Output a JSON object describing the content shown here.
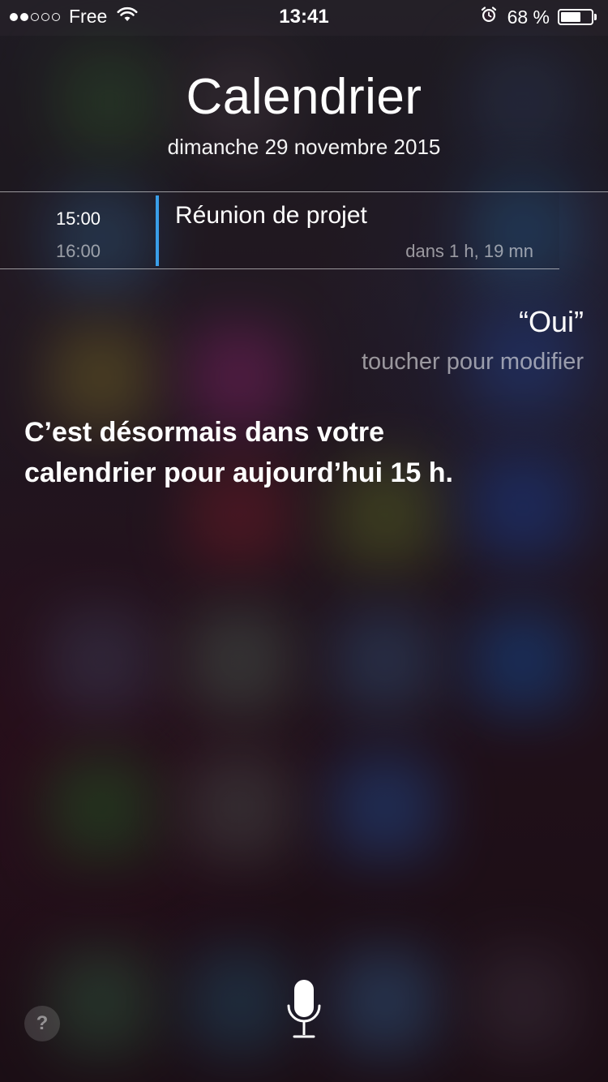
{
  "status_bar": {
    "carrier": "Free",
    "signal_bars_filled": 2,
    "signal_bars_total": 5,
    "time": "13:41",
    "battery_percent_label": "68 %",
    "battery_level": 0.68,
    "icons": [
      "wifi-icon",
      "alarm-icon",
      "battery-icon"
    ]
  },
  "calendar_card": {
    "title": "Calendrier",
    "date": "dimanche 29 novembre 2015",
    "event": {
      "start_time": "15:00",
      "end_time": "16:00",
      "title": "Réunion de projet",
      "relative_time": "dans 1 h, 19 mn",
      "accent_color": "#3a9ee8"
    }
  },
  "siri": {
    "user_utterance": "“Oui”",
    "edit_hint": "toucher pour modifier",
    "response": "C’est désormais dans votre calendrier pour aujourd’hui 15 h."
  },
  "controls": {
    "help_label": "?",
    "mic_icon": "microphone-icon"
  }
}
